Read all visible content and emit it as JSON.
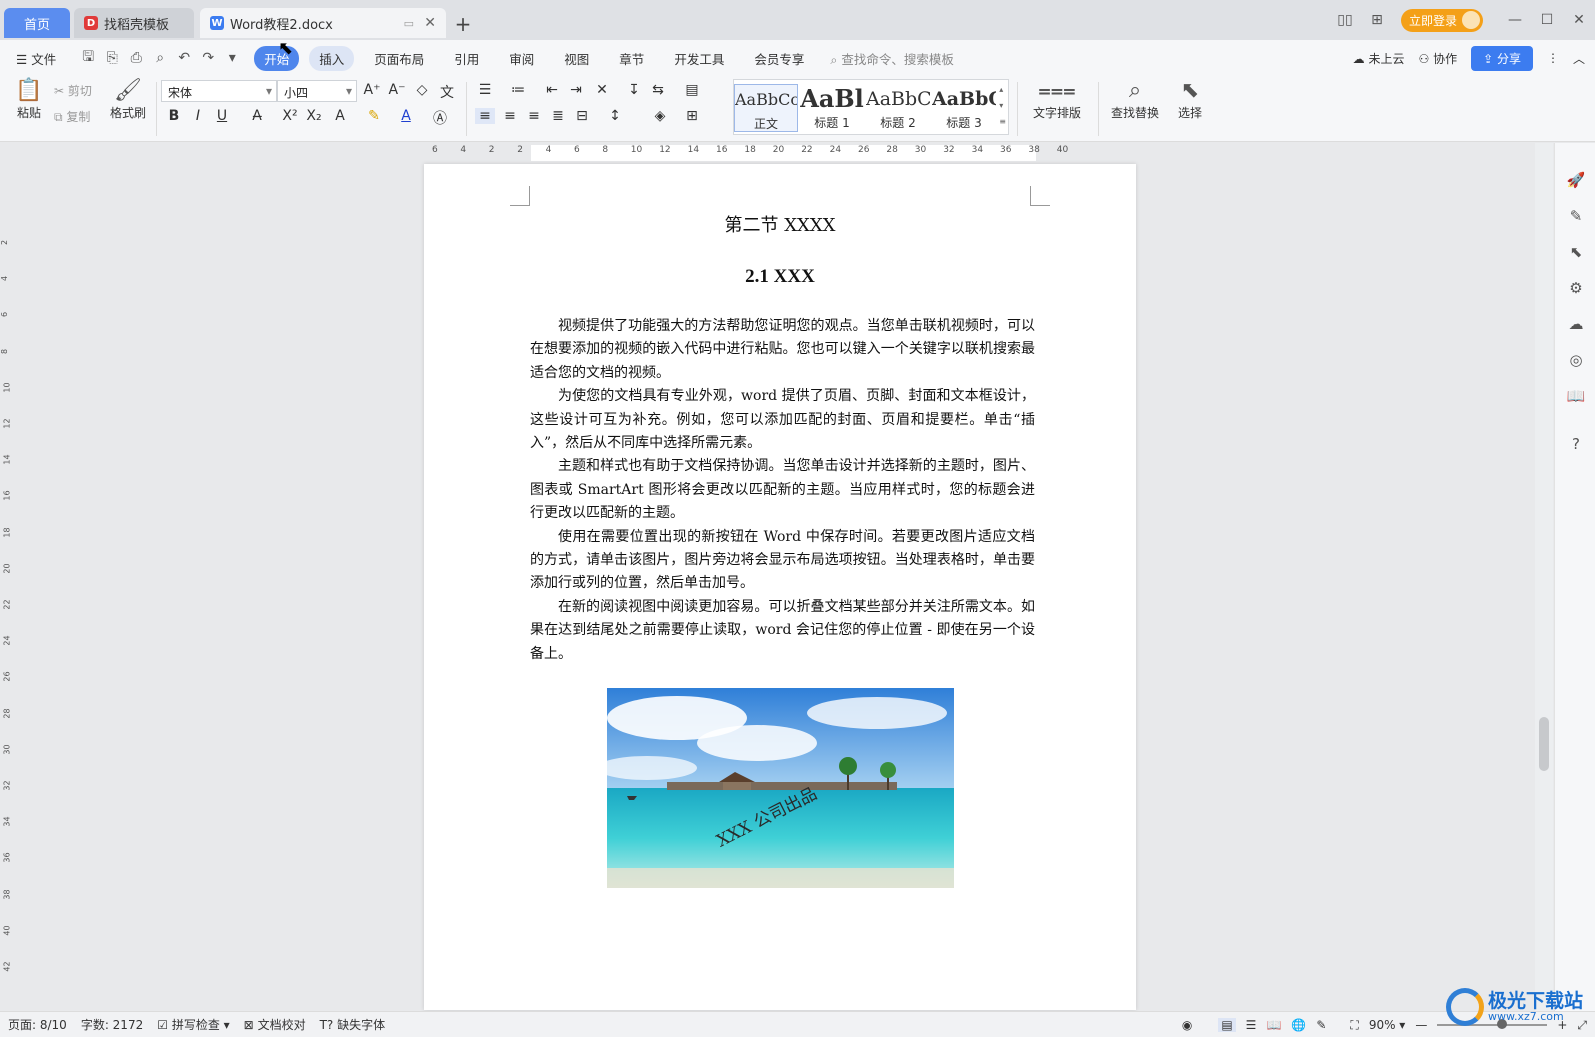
{
  "tabs": {
    "home": "首页",
    "template": "找稻壳模板",
    "document": "Word教程2.docx"
  },
  "titlebar": {
    "login": "立即登录"
  },
  "menu": {
    "file": "文件",
    "items": [
      "开始",
      "插入",
      "页面布局",
      "引用",
      "审阅",
      "视图",
      "章节",
      "开发工具",
      "会员专享"
    ],
    "search_placeholder": "查找命令、搜索模板",
    "cloud": "未上云",
    "collab": "协作",
    "share": "分享"
  },
  "ribbon": {
    "paste": "粘贴",
    "cut": "剪切",
    "copy": "复制",
    "format_painter": "格式刷",
    "font_name": "宋体",
    "font_size": "小四",
    "styles": [
      {
        "sample": "AaBbCcI",
        "name": "正文"
      },
      {
        "sample": "AaBl",
        "name": "标题 1"
      },
      {
        "sample": "AaBbC",
        "name": "标题 2"
      },
      {
        "sample": "AaBbC",
        "name": "标题 3"
      }
    ],
    "text_layout": "文字排版",
    "find_replace": "查找替换",
    "select": "选择"
  },
  "ruler": {
    "h_ticks": [
      "6",
      "4",
      "2",
      "2",
      "4",
      "6",
      "8",
      "10",
      "12",
      "14",
      "16",
      "18",
      "20",
      "22",
      "24",
      "26",
      "28",
      "30",
      "32",
      "34",
      "36",
      "38",
      "40"
    ],
    "v_ticks": [
      "2",
      "4",
      "6",
      "8",
      "10",
      "12",
      "14",
      "16",
      "18",
      "20",
      "22",
      "24",
      "26",
      "28",
      "30",
      "32",
      "34",
      "36",
      "38",
      "40",
      "42"
    ]
  },
  "document": {
    "heading": "第二节  XXXX",
    "subheading": "2.1 XXX",
    "paragraphs": [
      "视频提供了功能强大的方法帮助您证明您的观点。当您单击联机视频时，可以在想要添加的视频的嵌入代码中进行粘贴。您也可以键入一个关键字以联机搜索最适合您的文档的视频。",
      "为使您的文档具有专业外观，word 提供了页眉、页脚、封面和文本框设计，这些设计可互为补充。例如，您可以添加匹配的封面、页眉和提要栏。单击“插入”，然后从不同库中选择所需元素。",
      "主题和样式也有助于文档保持协调。当您单击设计并选择新的主题时，图片、图表或 SmartArt 图形将会更改以匹配新的主题。当应用样式时，您的标题会进行更改以匹配新的主题。",
      "使用在需要位置出现的新按钮在 Word 中保存时间。若要更改图片适应文档的方式，请单击该图片，图片旁边将会显示布局选项按钮。当处理表格时，单击要添加行或列的位置，然后单击加号。",
      "在新的阅读视图中阅读更加容易。可以折叠文档某些部分并关注所需文本。如果在达到结尾处之前需要停止读取，word 会记住您的停止位置 - 即使在另一个设备上。"
    ],
    "image_watermark": "XXX 公司出品"
  },
  "status": {
    "page": "页面: 8/10",
    "words": "字数: 2172",
    "spell": "拼写检查",
    "proof": "文档校对",
    "missing_font": "缺失字体",
    "zoom": "90%"
  },
  "watermark_logo": {
    "title": "极光下载站",
    "url": "www.xz7.com"
  }
}
